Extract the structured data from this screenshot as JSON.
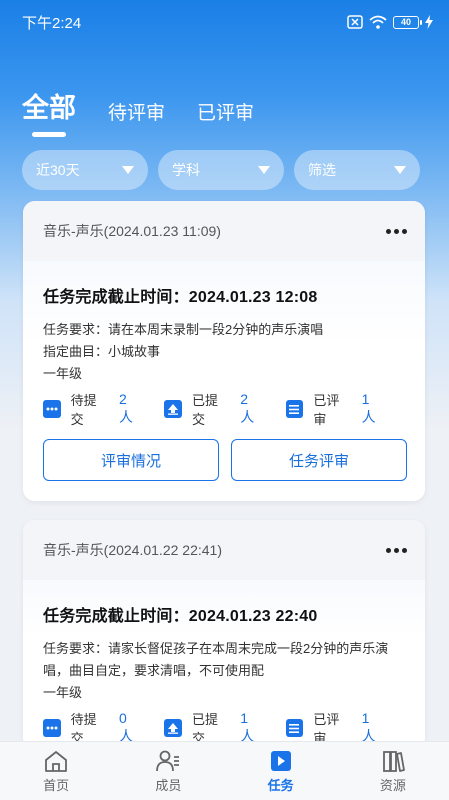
{
  "status_bar": {
    "time": "下午2:24",
    "battery": "40"
  },
  "tabs": [
    {
      "label": "全部",
      "active": true
    },
    {
      "label": "待评审",
      "active": false
    },
    {
      "label": "已评审",
      "active": false
    }
  ],
  "filters": [
    {
      "label": "近30天"
    },
    {
      "label": "学科"
    },
    {
      "label": "筛选"
    }
  ],
  "cards": [
    {
      "header": "音乐-声乐(2024.01.23 11:09)",
      "deadline": "任务完成截止时间：2024.01.23 12:08",
      "requirement": "任务要求：请在本周末录制一段2分钟的声乐演唱",
      "song": "指定曲目：小城故事",
      "grade": "一年级",
      "pending_label": "待提交",
      "pending_value": "2人",
      "submitted_label": "已提交",
      "submitted_value": "2人",
      "reviewed_label": "已评审",
      "reviewed_value": "1人",
      "btn_review_status": "评审情况",
      "btn_task_review": "任务评审"
    },
    {
      "header": "音乐-声乐(2024.01.22 22:41)",
      "deadline": "任务完成截止时间：2024.01.23 22:40",
      "requirement": "任务要求：请家长督促孩子在本周末完成一段2分钟的声乐演唱，曲目自定，要求清唱，不可使用配",
      "grade": "一年级",
      "pending_label": "待提交",
      "pending_value": "0人",
      "submitted_label": "已提交",
      "submitted_value": "1人",
      "reviewed_label": "已评审",
      "reviewed_value": "1人"
    }
  ],
  "nav": [
    {
      "label": "首页",
      "icon": "home-icon"
    },
    {
      "label": "成员",
      "icon": "members-icon"
    },
    {
      "label": "任务",
      "icon": "task-icon",
      "active": true
    },
    {
      "label": "资源",
      "icon": "resources-icon"
    }
  ],
  "colors": {
    "accent": "#1a73e8",
    "header_blue": "#1a7fe6"
  }
}
